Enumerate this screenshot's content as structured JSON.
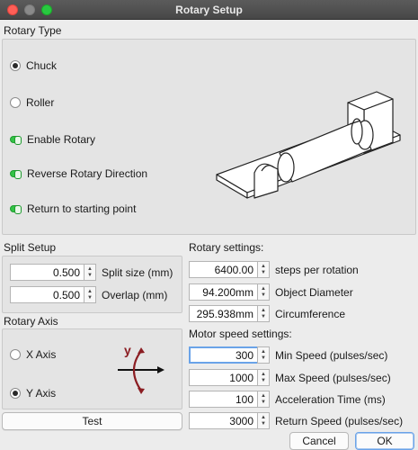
{
  "window": {
    "title": "Rotary Setup"
  },
  "rotary_type": {
    "heading": "Rotary Type",
    "options": [
      {
        "label": "Chuck",
        "selected": true
      },
      {
        "label": "Roller",
        "selected": false
      }
    ],
    "toggles": [
      {
        "label": "Enable Rotary",
        "on": true
      },
      {
        "label": "Reverse Rotary Direction",
        "on": true
      },
      {
        "label": "Return to starting point",
        "on": true
      }
    ]
  },
  "split_setup": {
    "heading": "Split Setup",
    "fields": [
      {
        "value": "0.500",
        "label": "Split size (mm)"
      },
      {
        "value": "0.500",
        "label": "Overlap (mm)"
      }
    ]
  },
  "rotary_axis": {
    "heading": "Rotary Axis",
    "options": [
      {
        "label": "X Axis",
        "selected": false
      },
      {
        "label": "Y Axis",
        "selected": true
      }
    ],
    "diagram_letter": "y",
    "accent_color": "#8b1d22"
  },
  "rotary_settings": {
    "heading": "Rotary settings:",
    "fields": [
      {
        "value": "6400.00",
        "label": "steps per rotation"
      },
      {
        "value": "94.200mm",
        "label": "Object Diameter"
      },
      {
        "value": "295.938mm",
        "label": "Circumference"
      }
    ]
  },
  "motor_speed": {
    "heading": "Motor speed settings:",
    "fields": [
      {
        "value": "300",
        "label": "Min Speed (pulses/sec)"
      },
      {
        "value": "1000",
        "label": "Max Speed (pulses/sec)"
      },
      {
        "value": "100",
        "label": "Acceleration Time (ms)"
      },
      {
        "value": "3000",
        "label": "Return Speed (pulses/sec)"
      }
    ]
  },
  "buttons": {
    "test": "Test",
    "cancel": "Cancel",
    "ok": "OK"
  }
}
